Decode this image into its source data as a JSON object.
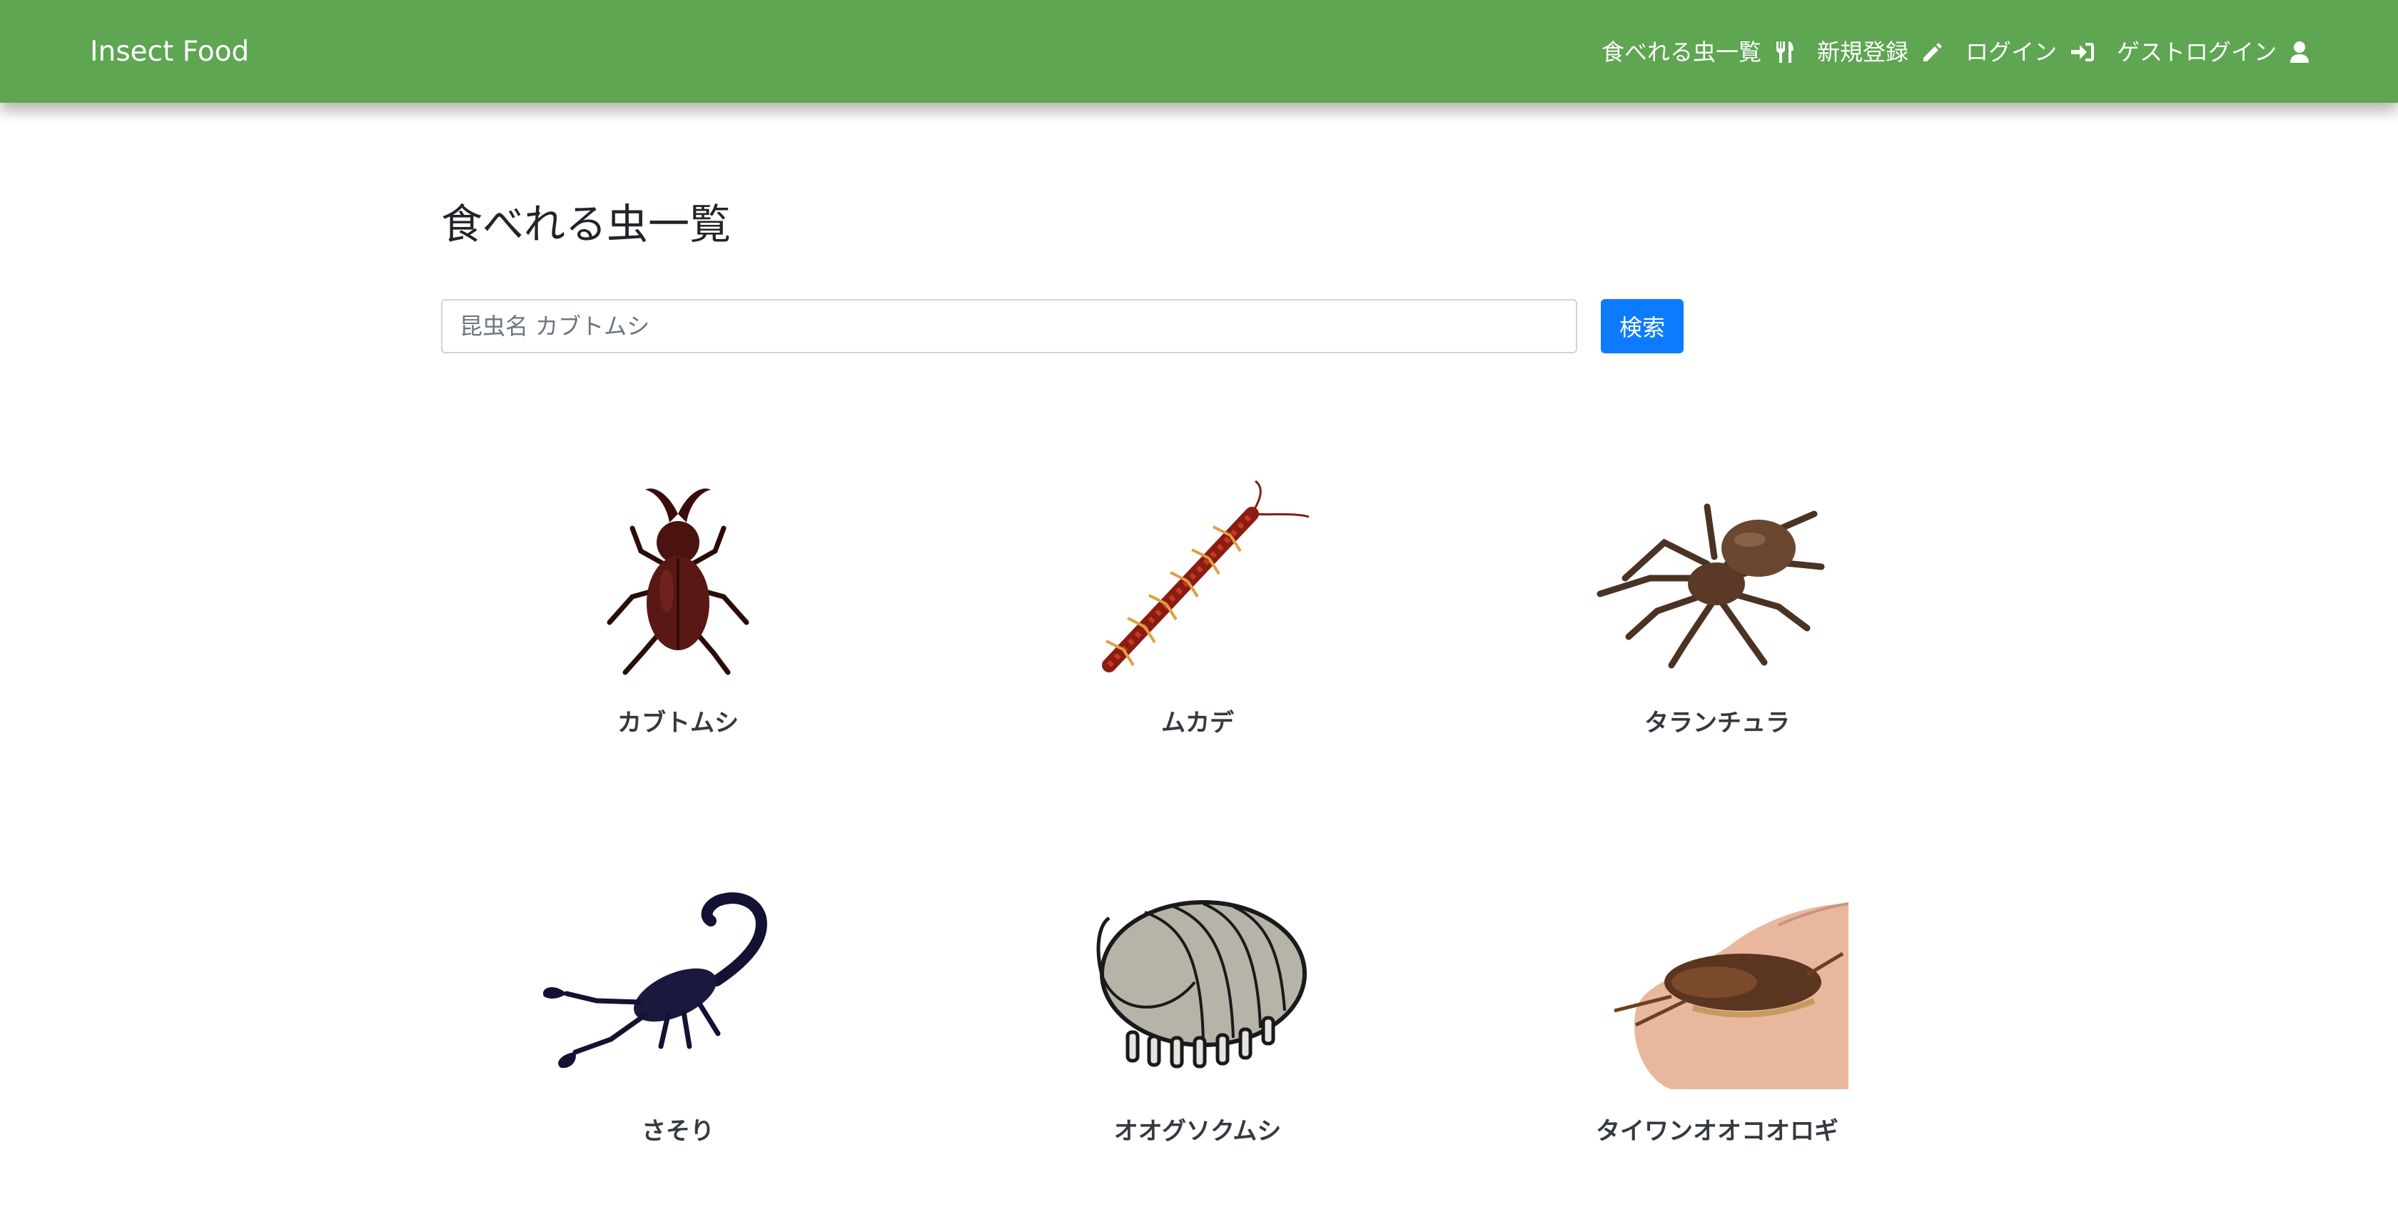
{
  "navbar": {
    "brand": "Insect Food",
    "links": [
      {
        "label": "食べれる虫一覧",
        "icon": "utensils-icon"
      },
      {
        "label": "新規登録",
        "icon": "pencil-icon"
      },
      {
        "label": "ログイン",
        "icon": "sign-in-icon"
      },
      {
        "label": "ゲストログイン",
        "icon": "user-icon"
      }
    ]
  },
  "main": {
    "title": "食べれる虫一覧",
    "search": {
      "placeholder": "昆虫名 カブトムシ",
      "value": "",
      "button_label": "検索"
    },
    "insects": [
      {
        "name": "カブトムシ",
        "image": "rhinoceros-beetle-image"
      },
      {
        "name": "ムカデ",
        "image": "centipede-image"
      },
      {
        "name": "タランチュラ",
        "image": "tarantula-image"
      },
      {
        "name": "さそり",
        "image": "scorpion-image"
      },
      {
        "name": "オオグソクムシ",
        "image": "giant-isopod-image"
      },
      {
        "name": "タイワンオオコオロギ",
        "image": "cricket-in-hand-photo"
      }
    ]
  },
  "colors": {
    "navbar": "#5ea652",
    "primary_button": "#0d7bff"
  }
}
